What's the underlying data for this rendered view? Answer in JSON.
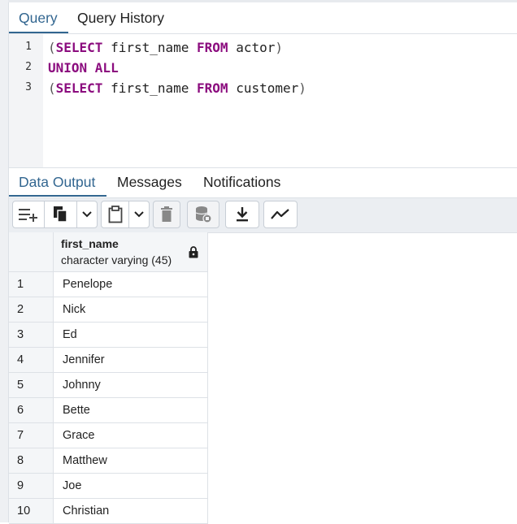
{
  "query_tabs": [
    "Query",
    "Query History"
  ],
  "editor": {
    "line_numbers": [
      "1",
      "2",
      "3"
    ],
    "lines": [
      {
        "open_paren": "(",
        "kw1": "SELECT",
        "text1": " first_name ",
        "kw2": "FROM",
        "text2": " actor",
        "close_paren": ")"
      },
      {
        "kw": "UNION ALL"
      },
      {
        "open_paren": "(",
        "kw1": "SELECT",
        "text1": " first_name ",
        "kw2": "FROM",
        "text2": " customer",
        "close_paren": ")"
      }
    ]
  },
  "result_tabs": [
    "Data Output",
    "Messages",
    "Notifications"
  ],
  "toolbar": {
    "icons": [
      "add-row-icon",
      "copy-icon",
      "chevron-down-icon",
      "paste-icon",
      "chevron-down-icon",
      "delete-icon",
      "save-data-icon",
      "download-icon",
      "graph-icon"
    ]
  },
  "grid": {
    "column": {
      "name": "first_name",
      "type": "character varying (45)",
      "icon": "lock-icon"
    },
    "rows": [
      {
        "num": "1",
        "value": "Penelope"
      },
      {
        "num": "2",
        "value": "Nick"
      },
      {
        "num": "3",
        "value": "Ed"
      },
      {
        "num": "4",
        "value": "Jennifer"
      },
      {
        "num": "5",
        "value": "Johnny"
      },
      {
        "num": "6",
        "value": "Bette"
      },
      {
        "num": "7",
        "value": "Grace"
      },
      {
        "num": "8",
        "value": "Matthew"
      },
      {
        "num": "9",
        "value": "Joe"
      },
      {
        "num": "10",
        "value": "Christian"
      }
    ]
  },
  "colors": {
    "accent": "#326690",
    "keyword": "#8b0c7e"
  }
}
